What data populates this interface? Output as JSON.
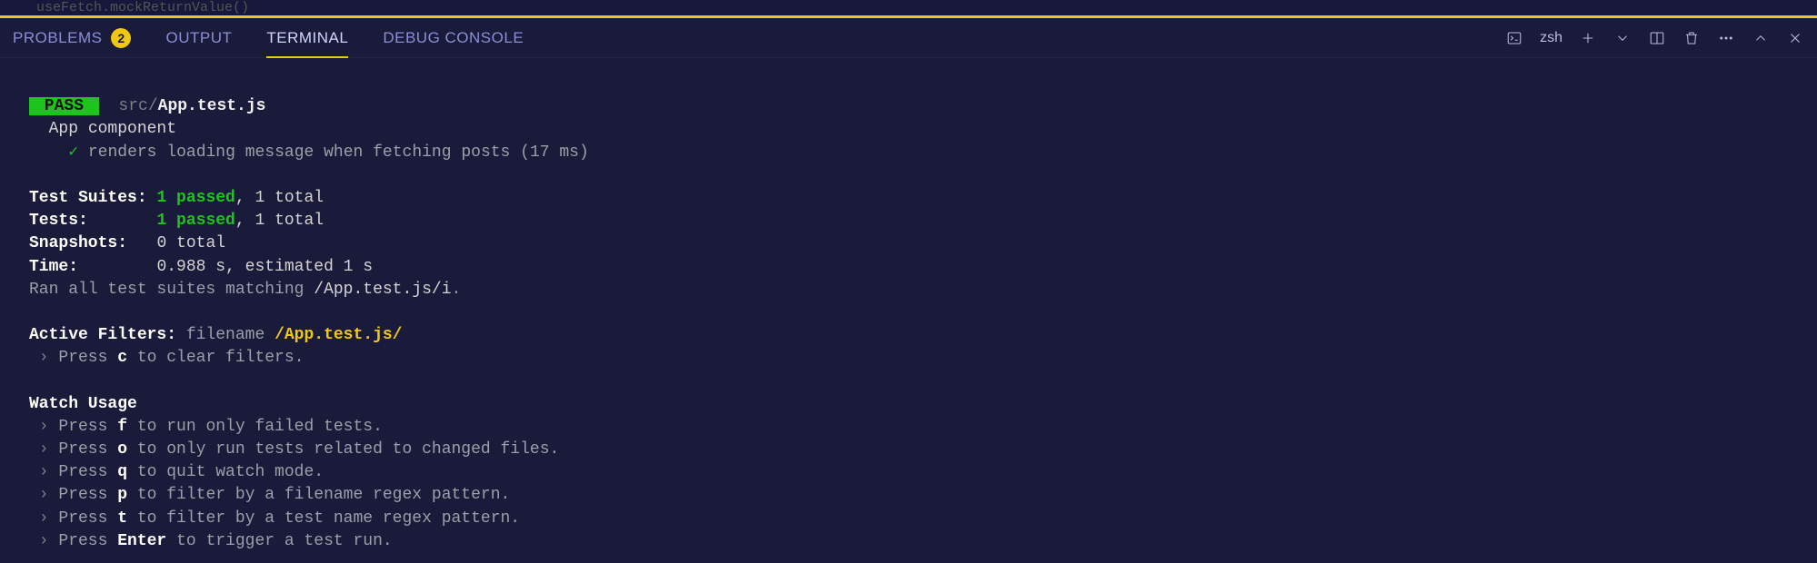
{
  "faded": {
    "text": "useFetch.mockReturnValue()"
  },
  "tabs": {
    "problems": "PROBLEMS",
    "problems_count": "2",
    "output": "OUTPUT",
    "terminal": "TERMINAL",
    "debug": "DEBUG CONSOLE"
  },
  "toolbar": {
    "shell": "zsh"
  },
  "test": {
    "pass": " PASS ",
    "path_dim": "src/",
    "path_bold": "App.test.js",
    "describe": "App component",
    "check": "✓",
    "it_line": "renders loading message when fetching posts (17 ms)"
  },
  "summary": {
    "suites_label": "Test Suites:",
    "suites_pass": "1 passed",
    "suites_rest": ", 1 total",
    "tests_label": "Tests:      ",
    "tests_pass": "1 passed",
    "tests_rest": ", 1 total",
    "snap_label": "Snapshots:  ",
    "snap_val": "0 total",
    "time_label": "Time:       ",
    "time_val": "0.988 s, estimated 1 s",
    "ran_a": "Ran all test suites matching ",
    "ran_b": "/App.test.js/i",
    "ran_c": "."
  },
  "filters": {
    "label": "Active Filters:",
    "text": " filename ",
    "pattern": "/App.test.js/",
    "clear_a": "Press ",
    "clear_k": "c",
    "clear_b": " to clear filters."
  },
  "watch": {
    "title": "Watch Usage",
    "p": " › ",
    "press": "Press ",
    "l1k": "f",
    "l1": " to run only failed tests.",
    "l2k": "o",
    "l2": " to only run tests related to changed files.",
    "l3k": "q",
    "l3": " to quit watch mode.",
    "l4k": "p",
    "l4": " to filter by a filename regex pattern.",
    "l5k": "t",
    "l5": " to filter by a test name regex pattern.",
    "l6k": "Enter",
    "l6": " to trigger a test run."
  }
}
